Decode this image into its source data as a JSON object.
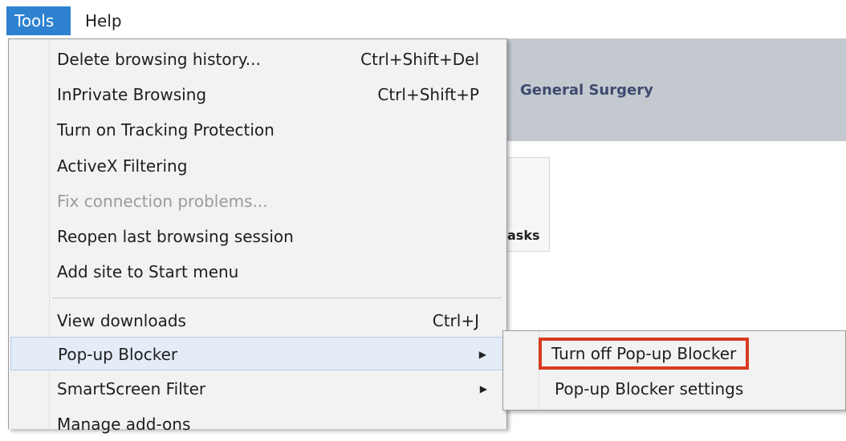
{
  "menubar": {
    "tools_label": "Tools",
    "help_label": "Help"
  },
  "page": {
    "banner_title": "General Surgery",
    "tile_label": "asks"
  },
  "tools_menu": {
    "items": [
      {
        "label": "Delete browsing history...",
        "shortcut": "Ctrl+Shift+Del",
        "enabled": true
      },
      {
        "label": "InPrivate Browsing",
        "shortcut": "Ctrl+Shift+P",
        "enabled": true
      },
      {
        "label": "Turn on Tracking Protection",
        "shortcut": "",
        "enabled": true
      },
      {
        "label": "ActiveX Filtering",
        "shortcut": "",
        "enabled": true
      },
      {
        "label": "Fix connection problems...",
        "shortcut": "",
        "enabled": false
      },
      {
        "label": "Reopen last browsing session",
        "shortcut": "",
        "enabled": true
      },
      {
        "label": "Add site to Start menu",
        "shortcut": "",
        "enabled": true
      },
      {
        "label": "View downloads",
        "shortcut": "Ctrl+J",
        "enabled": true
      },
      {
        "label": "Pop-up Blocker",
        "shortcut": "",
        "enabled": true,
        "submenu": true,
        "highlighted": true
      },
      {
        "label": "SmartScreen Filter",
        "shortcut": "",
        "enabled": true,
        "submenu": true
      },
      {
        "label": "Manage add-ons",
        "shortcut": "",
        "enabled": true
      }
    ]
  },
  "popup_submenu": {
    "items": [
      {
        "label": "Turn off Pop-up Blocker",
        "outlined": true
      },
      {
        "label": "Pop-up Blocker settings"
      }
    ]
  },
  "colors": {
    "menu_active": "#2f82d0",
    "highlight_outline": "#d83b1f",
    "hover_background": "#e3ecf7"
  }
}
